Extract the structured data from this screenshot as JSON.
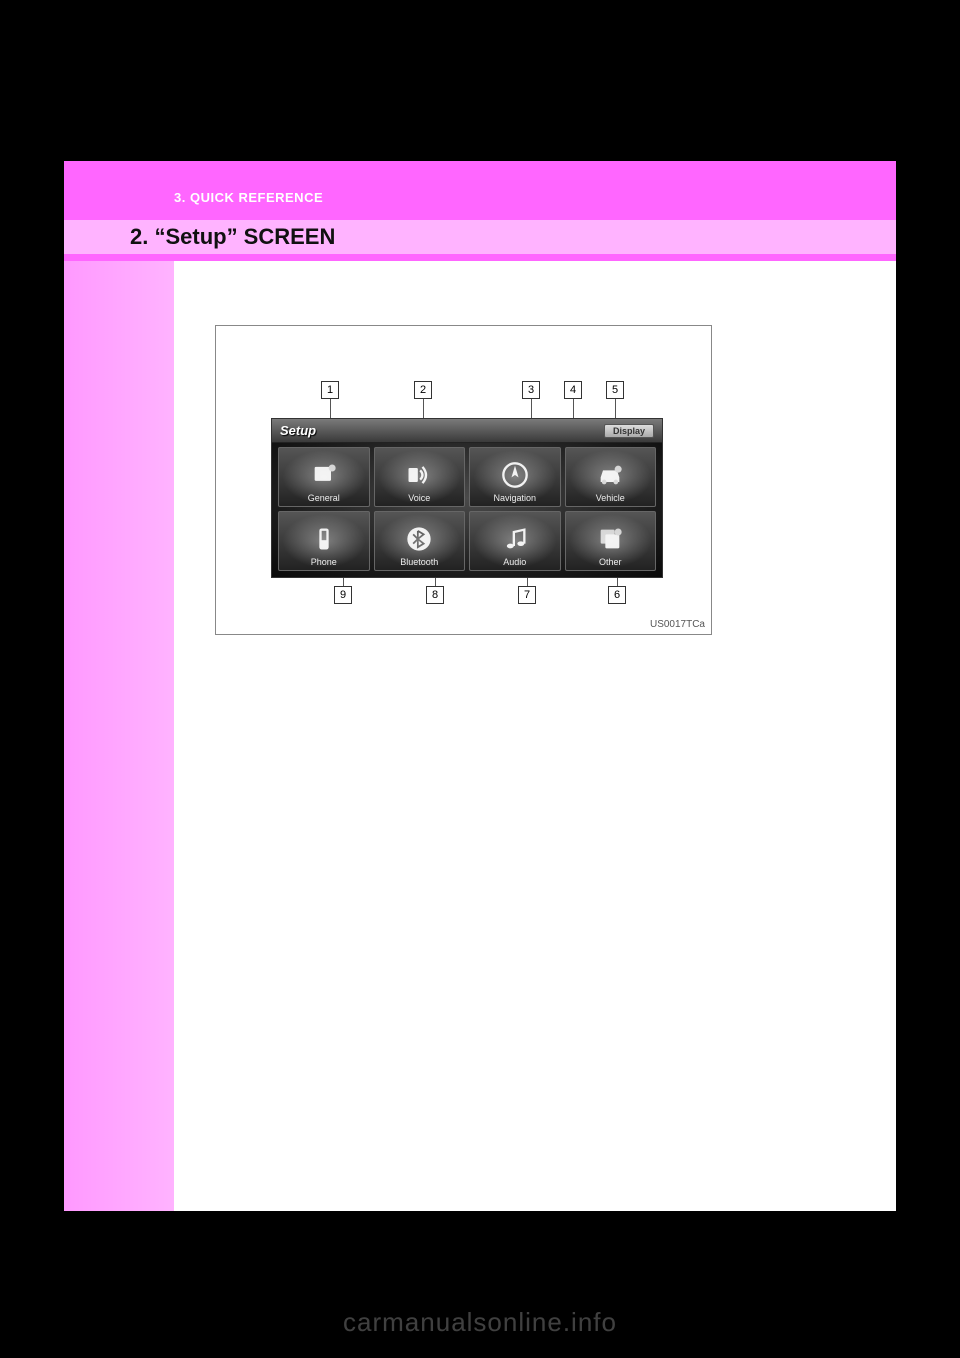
{
  "chapter": "3. QUICK REFERENCE",
  "title": "2. “Setup” SCREEN",
  "figure_code": "US0017TCa",
  "screen": {
    "header_label": "Setup",
    "display_button": "Display",
    "tiles": [
      {
        "label": "General"
      },
      {
        "label": "Voice"
      },
      {
        "label": "Navigation"
      },
      {
        "label": "Vehicle"
      },
      {
        "label": "Phone"
      },
      {
        "label": "Bluetooth"
      },
      {
        "label": "Audio"
      },
      {
        "label": "Other"
      }
    ]
  },
  "callouts": {
    "c1": "1",
    "c2": "2",
    "c3": "3",
    "c4": "4",
    "c5": "5",
    "c6": "6",
    "c7": "7",
    "c8": "8",
    "c9": "9"
  },
  "watermark": "carmanualsonline.info"
}
